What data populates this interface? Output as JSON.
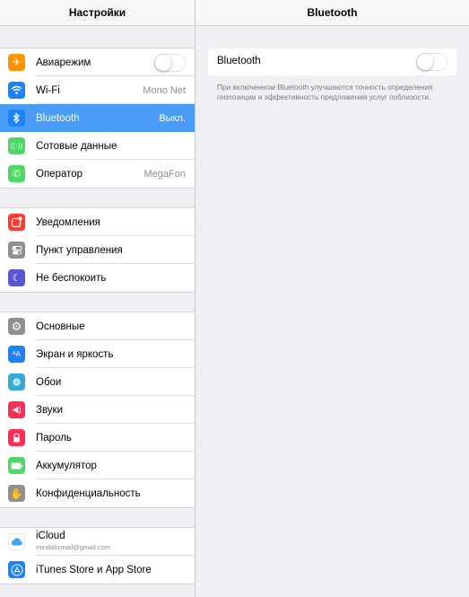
{
  "left_panel": {
    "title": "Настройки",
    "groups": [
      {
        "items": [
          {
            "label": "Авиарежим",
            "icon": "airplane-icon",
            "color": "#ff9500",
            "toggle": false
          },
          {
            "label": "Wi-Fi",
            "icon": "wifi-icon",
            "color": "#1a82fb",
            "value": "Mono Net"
          },
          {
            "label": "Bluetooth",
            "icon": "bluetooth-icon",
            "color": "#1a82fb",
            "value": "Выкл.",
            "selected": true
          },
          {
            "label": "Сотовые данные",
            "icon": "cellular-icon",
            "color": "#4cd964"
          },
          {
            "label": "Оператор",
            "icon": "phone-icon",
            "color": "#4cd964",
            "value": "MegaFon"
          }
        ]
      },
      {
        "items": [
          {
            "label": "Уведомления",
            "icon": "notifications-icon",
            "color": "#ff3b30"
          },
          {
            "label": "Пункт управления",
            "icon": "control-center-icon",
            "color": "#8e8e93"
          },
          {
            "label": "Не беспокоить",
            "icon": "moon-icon",
            "color": "#5856d6"
          }
        ]
      },
      {
        "items": [
          {
            "label": "Основные",
            "icon": "gear-icon",
            "color": "#8e8e93"
          },
          {
            "label": "Экран и яркость",
            "icon": "display-brightness-icon",
            "color": "#1a82fb"
          },
          {
            "label": "Обои",
            "icon": "wallpaper-icon",
            "color": "#34aadc"
          },
          {
            "label": "Звуки",
            "icon": "sounds-icon",
            "color": "#ff2d55"
          },
          {
            "label": "Пароль",
            "icon": "lock-icon",
            "color": "#ff2d55"
          },
          {
            "label": "Аккумулятор",
            "icon": "battery-icon",
            "color": "#4cd964"
          },
          {
            "label": "Конфиденциальность",
            "icon": "hand-icon",
            "color": "#8e8e93"
          }
        ]
      },
      {
        "items": [
          {
            "label": "iCloud",
            "sublabel": "mirabilizmail@gmail.com",
            "icon": "icloud-icon",
            "color": "#ffffff"
          },
          {
            "label": "iTunes Store и App Store",
            "icon": "app-store-icon",
            "color": "#1a82fb"
          }
        ]
      }
    ]
  },
  "right_panel": {
    "title": "Bluetooth",
    "bluetooth_label": "Bluetooth",
    "bluetooth_on": false,
    "note": "При включенном Bluetooth улучшаются точность определения геопозиции и эффективность предложения услуг поблизости."
  }
}
